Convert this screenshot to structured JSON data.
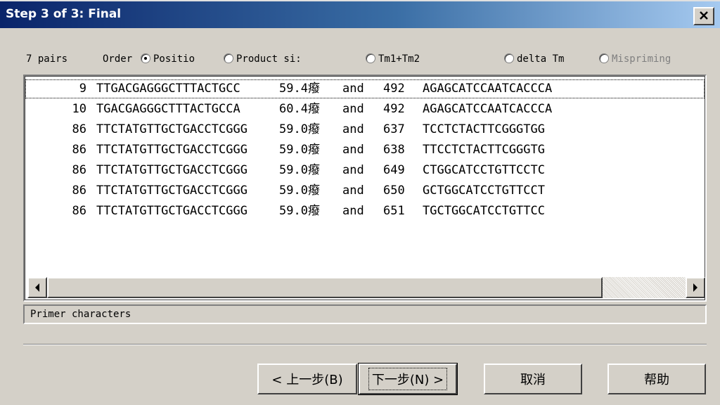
{
  "window": {
    "title": "Step 3 of 3: Final",
    "close_glyph": "✕"
  },
  "options": {
    "pairs_label": "7 pairs",
    "order_label": "Order",
    "radios": [
      {
        "label": "Positio",
        "checked": true,
        "enabled": true
      },
      {
        "label": "Product si:",
        "checked": false,
        "enabled": true
      },
      {
        "label": "Tm1+Tm2",
        "checked": false,
        "enabled": true
      },
      {
        "label": "delta Tm",
        "checked": false,
        "enabled": true
      },
      {
        "label": "Mispriming",
        "checked": false,
        "enabled": false
      }
    ]
  },
  "pairs": [
    {
      "pos": "9",
      "seq": "TTGACGAGGGCTTTACTGCC",
      "tm": "59.4癈",
      "and": "and",
      "pos2": "492",
      "seq2": "AGAGCATCCAATCACCCA"
    },
    {
      "pos": "10",
      "seq": "TGACGAGGGCTTTACTGCCA",
      "tm": "60.4癈",
      "and": "and",
      "pos2": "492",
      "seq2": "AGAGCATCCAATCACCCA"
    },
    {
      "pos": "86",
      "seq": "TTCTATGTTGCTGACCTCGGG",
      "tm": "59.0癈",
      "and": "and",
      "pos2": "637",
      "seq2": "TCCTCTACTTCGGGTGG"
    },
    {
      "pos": "86",
      "seq": "TTCTATGTTGCTGACCTCGGG",
      "tm": "59.0癈",
      "and": "and",
      "pos2": "638",
      "seq2": "TTCCTCTACTTCGGGTG"
    },
    {
      "pos": "86",
      "seq": "TTCTATGTTGCTGACCTCGGG",
      "tm": "59.0癈",
      "and": "and",
      "pos2": "649",
      "seq2": "CTGGCATCCTGTTCCTC"
    },
    {
      "pos": "86",
      "seq": "TTCTATGTTGCTGACCTCGGG",
      "tm": "59.0癈",
      "and": "and",
      "pos2": "650",
      "seq2": "GCTGGCATCCTGTTCCT"
    },
    {
      "pos": "86",
      "seq": "TTCTATGTTGCTGACCTCGGG",
      "tm": "59.0癈",
      "and": "and",
      "pos2": "651",
      "seq2": "TGCTGGCATCCTGTTCC"
    }
  ],
  "status_text": "Primer characters",
  "buttons": {
    "back": "< 上一步(B)",
    "next": "下一步(N) >",
    "cancel": "取消",
    "help": "帮助"
  }
}
